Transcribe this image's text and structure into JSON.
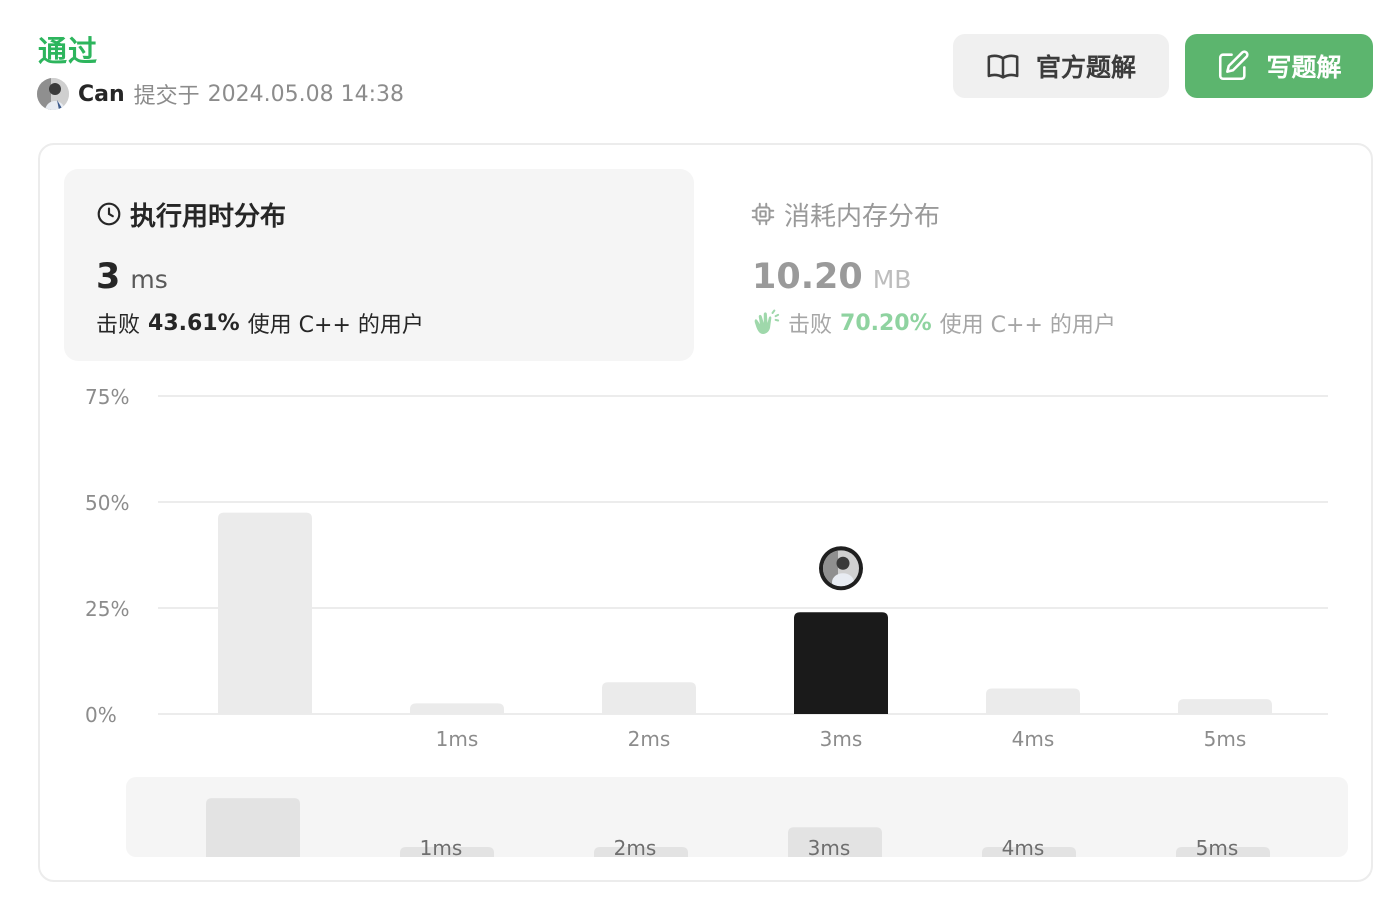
{
  "header": {
    "status": "通过",
    "username": "Can",
    "submit_text": "提交于",
    "submit_time": "2024.05.08 14:38"
  },
  "buttons": {
    "official_solution": "官方题解",
    "write_solution": "写题解"
  },
  "runtime": {
    "title": "执行用时分布",
    "value": "3",
    "unit": "ms",
    "beats_prefix": "击败",
    "beats_pct": "43.61%",
    "beats_suffix": "使用 C++ 的用户"
  },
  "memory": {
    "title": "消耗内存分布",
    "value": "10.20",
    "unit": "MB",
    "beats_prefix": "击败",
    "beats_pct": "70.20%",
    "beats_suffix": "使用 C++ 的用户"
  },
  "colors": {
    "accent_green": "#2db55d",
    "button_green": "#5cb56e",
    "bar_default": "#ebebeb",
    "bar_selected": "#1a1a1a"
  },
  "chart_data": [
    {
      "type": "bar",
      "categories": [
        "",
        "1ms",
        "2ms",
        "3ms",
        "4ms",
        "5ms"
      ],
      "values": [
        47.5,
        2.5,
        7.5,
        24,
        6,
        3.5
      ],
      "highlighted_index": 3,
      "yticks": [
        "0%",
        "25%",
        "50%",
        "75%"
      ],
      "ylim": [
        0,
        75
      ],
      "grid": true
    },
    {
      "type": "bar",
      "categories": [
        "",
        "1ms",
        "2ms",
        "3ms",
        "4ms",
        "5ms"
      ],
      "values": [
        47.5,
        2.5,
        7.5,
        24,
        6,
        3.5
      ],
      "ylim": [
        0,
        50
      ]
    }
  ]
}
